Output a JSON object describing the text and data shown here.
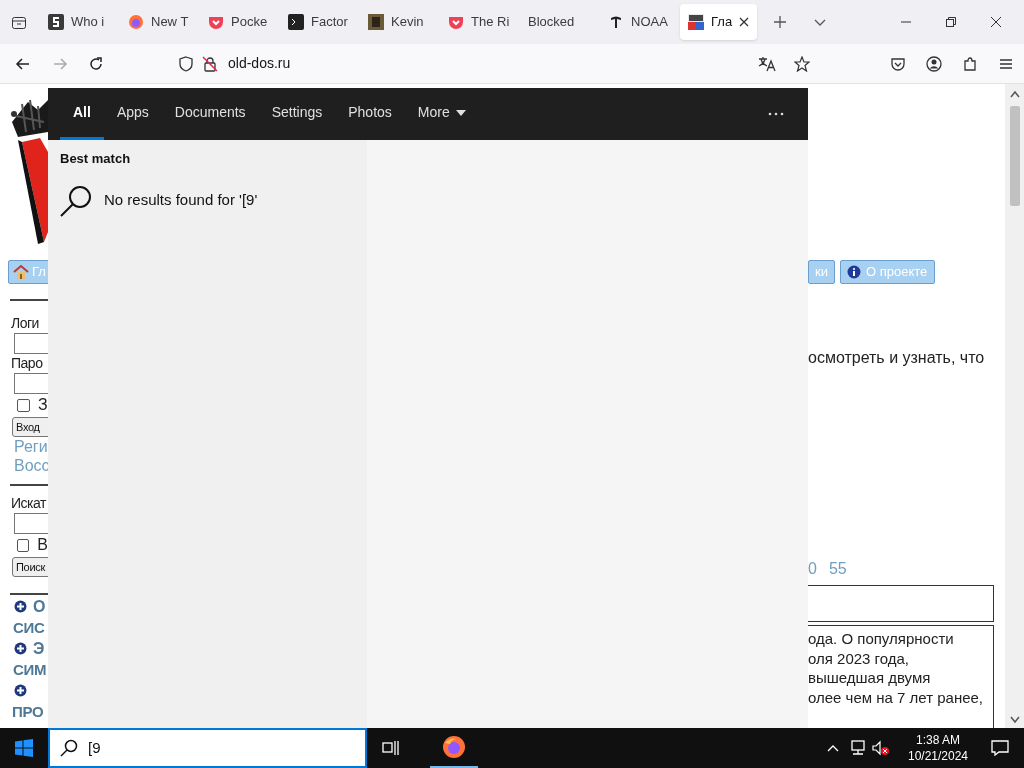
{
  "browser": {
    "tabs": [
      {
        "title": "Who i",
        "selected": false
      },
      {
        "title": "New T",
        "selected": false
      },
      {
        "title": "Pocke",
        "selected": false
      },
      {
        "title": "Factor",
        "selected": false
      },
      {
        "title": "Kevin",
        "selected": false
      },
      {
        "title": "The Ri",
        "selected": false
      },
      {
        "title": "Blocked",
        "selected": false
      },
      {
        "title": "NOAA",
        "selected": false
      },
      {
        "title": "Гла",
        "selected": true
      }
    ],
    "address": "old-dos.ru"
  },
  "page": {
    "left": [
      {
        "kind": "nav-button",
        "text": "Гл"
      },
      {
        "kind": "rule"
      },
      {
        "kind": "label",
        "text": "Логи"
      },
      {
        "kind": "input"
      },
      {
        "kind": "label",
        "text": "Паро"
      },
      {
        "kind": "input"
      },
      {
        "kind": "checkbox",
        "text": "З",
        "checked": false
      },
      {
        "kind": "button",
        "text": "Вход"
      },
      {
        "kind": "link",
        "text": "Реги"
      },
      {
        "kind": "link",
        "text": "Восс"
      },
      {
        "kind": "rule"
      },
      {
        "kind": "label",
        "text": "Искат"
      },
      {
        "kind": "input"
      },
      {
        "kind": "checkbox",
        "text": "В",
        "checked": false
      },
      {
        "kind": "button",
        "text": "Поиск"
      },
      {
        "kind": "rule"
      },
      {
        "kind": "category",
        "lines": [
          "О",
          "СИС"
        ]
      },
      {
        "kind": "category",
        "lines": [
          "Э",
          "СИМ"
        ]
      },
      {
        "kind": "category",
        "lines": [
          "ПРО"
        ]
      }
    ],
    "right": {
      "nav_buttons": [
        "ки",
        "О проекте"
      ],
      "intro": "осмотреть и узнать, что",
      "page_links": [
        "0",
        "55"
      ],
      "article_lines": [
        "ода. О популярности",
        "оля 2023 года,",
        "вышедшая двумя",
        "олее чем на 7 лет ранее,"
      ]
    }
  },
  "search": {
    "tabs": [
      {
        "label": "All",
        "selected": true,
        "kind": "tab"
      },
      {
        "label": "Apps",
        "selected": false,
        "kind": "tab"
      },
      {
        "label": "Documents",
        "selected": false,
        "kind": "tab"
      },
      {
        "label": "Settings",
        "selected": false,
        "kind": "tab"
      },
      {
        "label": "Photos",
        "selected": false,
        "kind": "tab"
      },
      {
        "label": "More",
        "selected": false,
        "kind": "dropdown"
      }
    ],
    "section": "Best match",
    "message": "No results found for '[9'",
    "query": "[9"
  },
  "taskbar": {
    "time": "1:38 AM",
    "date": "10/21/2024"
  }
}
